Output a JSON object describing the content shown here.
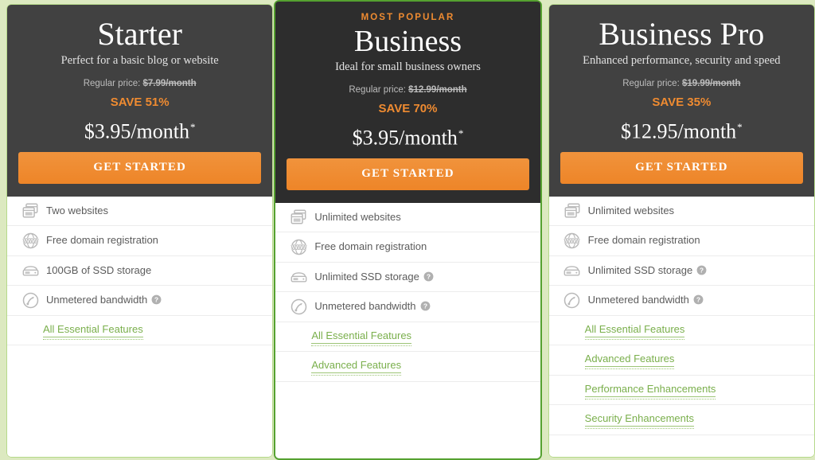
{
  "theme": {
    "page_background": "#dce9c0",
    "header_dark": "#414141",
    "header_dark_featured": "#2d2d2d",
    "accent_orange": "#ef8b31",
    "link_green": "#7aaf4c",
    "border_green": "#b5d98a",
    "border_green_featured": "#55a130"
  },
  "plans": [
    {
      "id": "starter",
      "badge": "",
      "name": "Starter",
      "tagline": "Perfect for a basic blog or website",
      "regular_price_label": "Regular price:",
      "regular_price_value": "$7.99/month",
      "save_label": "SAVE 51%",
      "price": "$3.95/month",
      "price_asterisk": "*",
      "cta_label": "GET STARTED",
      "features": [
        {
          "icon": "websites-icon",
          "text": "Two websites",
          "help": false
        },
        {
          "icon": "www-globe-icon",
          "text": "Free domain registration",
          "help": false
        },
        {
          "icon": "ssd-storage-icon",
          "text": "100GB of SSD storage",
          "help": false
        },
        {
          "icon": "bandwidth-icon",
          "text": "Unmetered bandwidth",
          "help": true
        }
      ],
      "links": [
        "All Essential Features"
      ]
    },
    {
      "id": "business",
      "badge": "MOST POPULAR",
      "name": "Business",
      "tagline": "Ideal for small business owners",
      "regular_price_label": "Regular price:",
      "regular_price_value": "$12.99/month",
      "save_label": "SAVE 70%",
      "price": "$3.95/month",
      "price_asterisk": "*",
      "cta_label": "GET STARTED",
      "features": [
        {
          "icon": "websites-icon",
          "text": "Unlimited websites",
          "help": false
        },
        {
          "icon": "www-globe-icon",
          "text": "Free domain registration",
          "help": false
        },
        {
          "icon": "ssd-storage-icon",
          "text": "Unlimited SSD storage",
          "help": true
        },
        {
          "icon": "bandwidth-icon",
          "text": "Unmetered bandwidth",
          "help": true
        }
      ],
      "links": [
        "All Essential Features",
        "Advanced Features"
      ]
    },
    {
      "id": "business-pro",
      "badge": "",
      "name": "Business Pro",
      "tagline": "Enhanced performance, security and speed",
      "regular_price_label": "Regular price:",
      "regular_price_value": "$19.99/month",
      "save_label": "SAVE 35%",
      "price": "$12.95/month",
      "price_asterisk": "*",
      "cta_label": "GET STARTED",
      "features": [
        {
          "icon": "websites-icon",
          "text": "Unlimited websites",
          "help": false
        },
        {
          "icon": "www-globe-icon",
          "text": "Free domain registration",
          "help": false
        },
        {
          "icon": "ssd-storage-icon",
          "text": "Unlimited SSD storage",
          "help": true
        },
        {
          "icon": "bandwidth-icon",
          "text": "Unmetered bandwidth",
          "help": true
        }
      ],
      "links": [
        "All Essential Features",
        "Advanced Features",
        "Performance Enhancements",
        "Security Enhancements"
      ]
    }
  ]
}
